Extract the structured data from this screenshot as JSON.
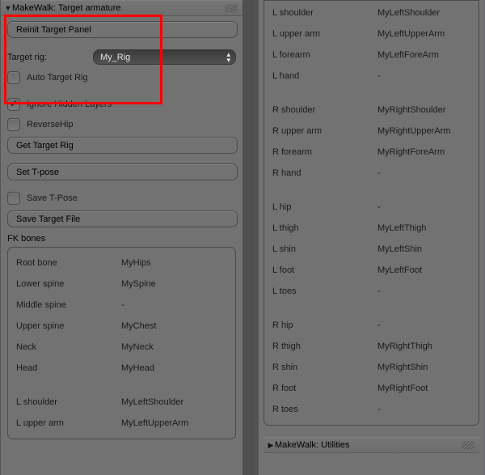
{
  "left_panel": {
    "header": "MakeWalk: Target armature",
    "reinit_btn": "Reinit Target Panel",
    "target_rig_label": "Target rig:",
    "target_rig_value": "My_Rig",
    "auto_target_label": "Auto Target Rig",
    "auto_target_checked": false,
    "ignore_hidden_label": "Ignore Hidden Layers",
    "ignore_hidden_checked": true,
    "reverse_hip_label": "ReverseHip",
    "reverse_hip_checked": false,
    "get_target_btn": "Get Target Rig",
    "set_tpose_btn": "Set T-pose",
    "save_tpose_label": "Save T-Pose",
    "save_tpose_checked": false,
    "save_target_btn": "Save Target File",
    "fk_title": "FK bones",
    "fk_rows": [
      {
        "l": "Root bone",
        "r": "MyHips"
      },
      {
        "l": "Lower spine",
        "r": "MySpine"
      },
      {
        "l": "Middle spine",
        "r": "-"
      },
      {
        "l": "Upper spine",
        "r": "MyChest"
      },
      {
        "l": "Neck",
        "r": "MyNeck"
      },
      {
        "l": "Head",
        "r": "MyHead"
      }
    ],
    "fk_rows2": [
      {
        "l": "L shoulder",
        "r": "MyLeftShoulder"
      },
      {
        "l": "L upper arm",
        "r": "MyLeftUpperArm"
      }
    ]
  },
  "right_panel": {
    "rows1": [
      {
        "l": "L shoulder",
        "r": "MyLeftShoulder"
      },
      {
        "l": "L upper arm",
        "r": "MyLeftUpperArm"
      },
      {
        "l": "L forearm",
        "r": "MyLeftForeArm"
      },
      {
        "l": "L hand",
        "r": "-"
      }
    ],
    "rows2": [
      {
        "l": "R shoulder",
        "r": "MyRightShoulder"
      },
      {
        "l": "R upper arm",
        "r": "MyRightUpperArm"
      },
      {
        "l": "R forearm",
        "r": "MyRightForeArm"
      },
      {
        "l": "R hand",
        "r": "-"
      }
    ],
    "rows3": [
      {
        "l": "L hip",
        "r": "-"
      },
      {
        "l": "L thigh",
        "r": "MyLeftThigh"
      },
      {
        "l": "L shin",
        "r": "MyLeftShin"
      },
      {
        "l": "L foot",
        "r": "MyLeftFoot"
      },
      {
        "l": "L toes",
        "r": "-"
      }
    ],
    "rows4": [
      {
        "l": "R hip",
        "r": "-"
      },
      {
        "l": "R thigh",
        "r": "MyRightThigh"
      },
      {
        "l": "R shin",
        "r": "MyRightShin"
      },
      {
        "l": "R foot",
        "r": "MyRightFoot"
      },
      {
        "l": "R toes",
        "r": "-"
      }
    ],
    "util_header": "MakeWalk: Utilities"
  }
}
